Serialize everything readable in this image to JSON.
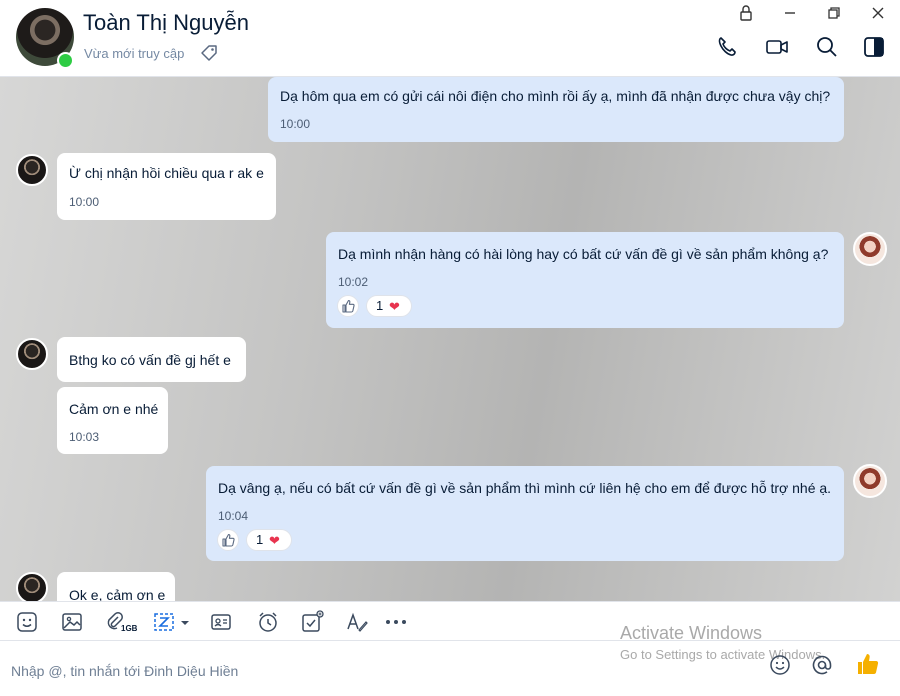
{
  "header": {
    "contact_name": "Toàn Thị Nguyễn",
    "presence": "Vừa mới truy cập"
  },
  "messages": [
    {
      "id": "m1",
      "side": "sent",
      "text": "Dạ hôm qua em có gửi cái nôi điện cho mình rồi ấy ạ, mình đã nhận được chưa vậy chị?",
      "time": "10:00"
    },
    {
      "id": "m2",
      "side": "received",
      "text": "Ừ chị nhận hồi chiều qua r ak e",
      "time": "10:00"
    },
    {
      "id": "m3",
      "side": "sent",
      "text": "Dạ mình nhận hàng có hài lòng hay có bất cứ vấn đề gì về sản phẩm không ạ?",
      "time": "10:02",
      "reaction_count": "1"
    },
    {
      "id": "m4",
      "side": "received",
      "text": "Bthg ko có vấn đề gj hết e"
    },
    {
      "id": "m5",
      "side": "received",
      "text": "Cảm ơn e nhé",
      "time": "10:03"
    },
    {
      "id": "m6",
      "side": "sent",
      "text": "Dạ vâng ạ, nếu có bất cứ vấn đề gì về sản phẩm thì mình cứ liên hệ cho em để được hỗ trợ nhé ạ.",
      "time": "10:04",
      "reaction_count": "1"
    },
    {
      "id": "m7",
      "side": "received",
      "text": "Ok e, cảm ơn e"
    }
  ],
  "toolbar": {
    "items": [
      "sticker-icon",
      "image-icon",
      "attach-icon",
      "screenshot-icon",
      "contact-card-icon",
      "reminder-icon",
      "todo-icon",
      "format-text-icon",
      "more-icon"
    ],
    "file_limit": "1GB"
  },
  "composer": {
    "placeholder": "Nhập @, tin nhắn tới Đinh Diệu Hiền"
  },
  "watermark": {
    "line1": "Activate Windows",
    "line2": "Go to Settings to activate Windows."
  },
  "colors": {
    "sent_bubble": "#dbe8fb",
    "received_bubble": "#ffffff",
    "online": "#2ecc44",
    "heart": "#e8344f",
    "like": "#f5b000"
  }
}
